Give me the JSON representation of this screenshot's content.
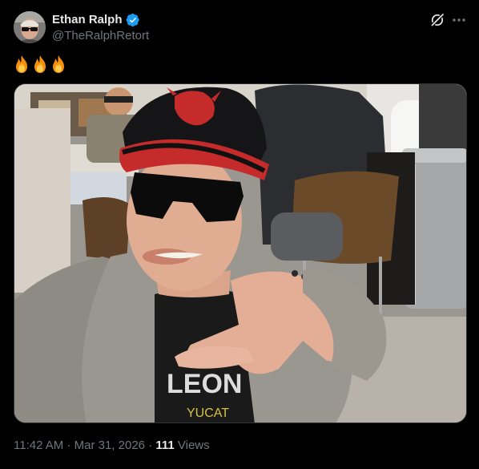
{
  "author": {
    "display_name": "Ethan Ralph",
    "handle": "@TheRalphRetort",
    "verified": true,
    "avatar_icon": "profile-photo"
  },
  "post": {
    "text": "🔥🔥🔥",
    "emojis": [
      "fire",
      "fire",
      "fire"
    ],
    "media_icon": "selfie-photo",
    "photo_caption_text": "LEON YUCAT"
  },
  "meta": {
    "time": "11:42 AM",
    "separator": "·",
    "date": "Mar 31, 2026",
    "views_count": "111",
    "views_label": "Views"
  },
  "actions": {
    "grok_icon": "grok-icon",
    "more_icon": "more-icon"
  },
  "colors": {
    "background": "#000000",
    "primary_text": "#e7e9ea",
    "secondary_text": "#71767b",
    "verified_badge": "#1d9bf0",
    "border": "#2f3336"
  }
}
